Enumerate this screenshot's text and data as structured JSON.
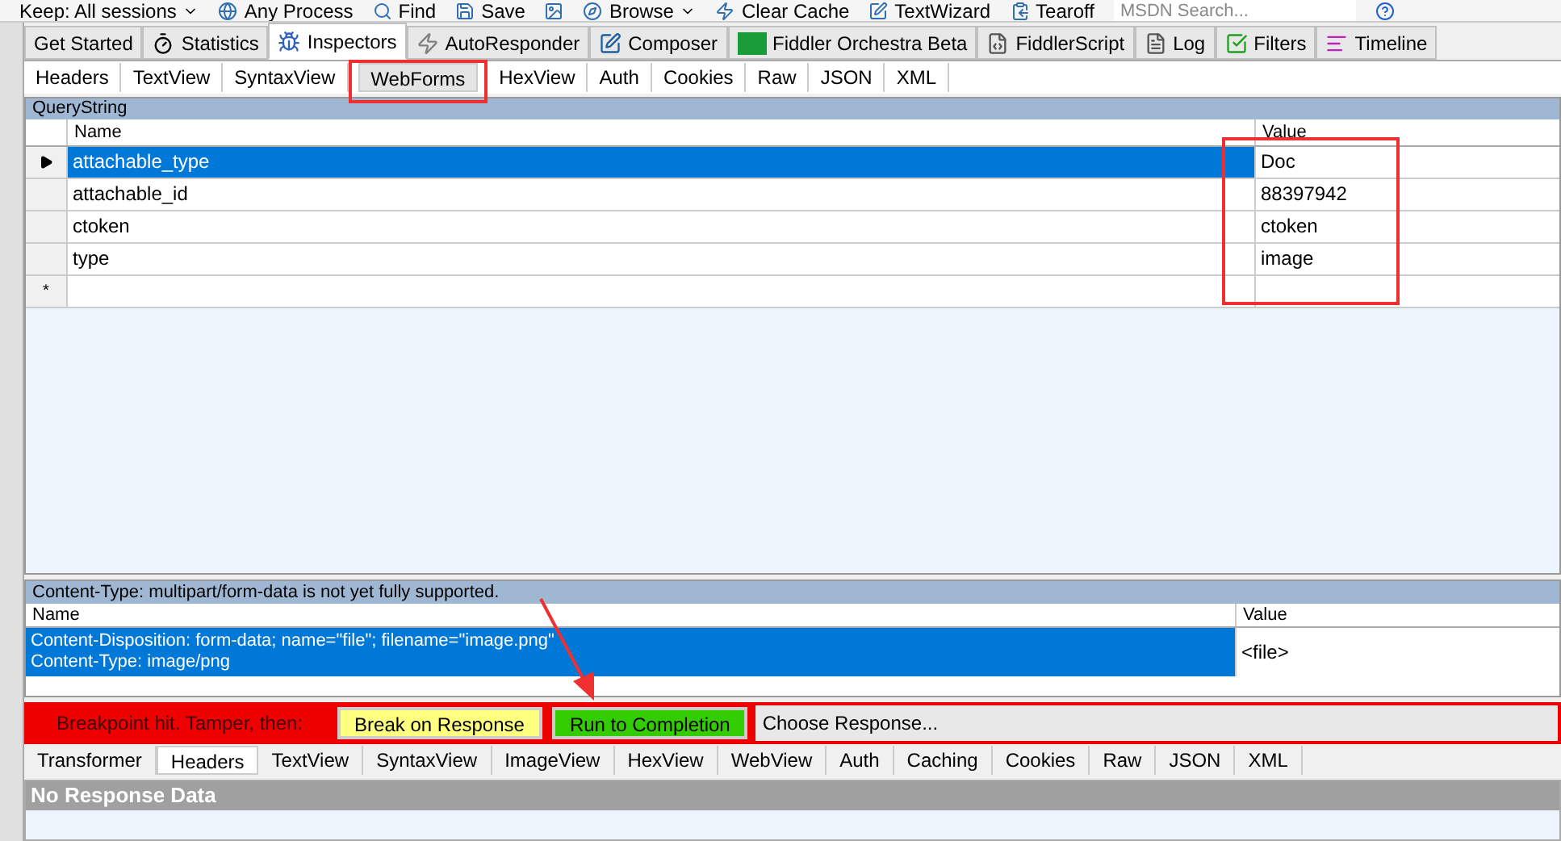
{
  "toolbar": [
    {
      "label": "Keep: All sessions",
      "dropdown": true
    },
    {
      "label": "Any Process",
      "dropdown": false
    },
    {
      "label": "Find",
      "dropdown": false
    },
    {
      "label": "Save",
      "dropdown": false
    },
    {
      "dropdown": false
    },
    {
      "label": "Browse",
      "dropdown": true
    },
    {
      "label": "Clear Cache",
      "dropdown": false
    },
    {
      "label": "TextWizard",
      "dropdown": false
    },
    {
      "label": "Tearoff",
      "dropdown": false
    }
  ],
  "search": {
    "placeholder": "MSDN Search..."
  },
  "tabs": [
    {
      "label": "Get Started",
      "selected": false
    },
    {
      "label": "Statistics",
      "selected": false
    },
    {
      "label": "Inspectors",
      "selected": true
    },
    {
      "label": "AutoResponder",
      "selected": false
    },
    {
      "label": "Composer",
      "selected": false
    },
    {
      "label": "Fiddler Orchestra Beta",
      "selected": false
    },
    {
      "label": "FiddlerScript",
      "selected": false
    },
    {
      "label": "Log",
      "selected": false
    },
    {
      "label": "Filters",
      "selected": false
    },
    {
      "label": "Timeline",
      "selected": false
    }
  ],
  "request_tabs": [
    {
      "label": "Headers",
      "selected": false
    },
    {
      "label": "TextView",
      "selected": false
    },
    {
      "label": "SyntaxView",
      "selected": false
    },
    {
      "label": "WebForms",
      "selected": true
    },
    {
      "label": "HexView",
      "selected": false
    },
    {
      "label": "Auth",
      "selected": false
    },
    {
      "label": "Cookies",
      "selected": false
    },
    {
      "label": "Raw",
      "selected": false
    },
    {
      "label": "JSON",
      "selected": false
    },
    {
      "label": "XML",
      "selected": false
    }
  ],
  "querystring": {
    "title": "QueryString",
    "columns": [
      "Name",
      "Value"
    ],
    "rows": [
      {
        "name": "attachable_type",
        "value": "Doc",
        "selected": true
      },
      {
        "name": "attachable_id",
        "value": "88397942",
        "selected": false
      },
      {
        "name": "ctoken",
        "value": "ctoken",
        "selected": false
      },
      {
        "name": "type",
        "value": "image",
        "selected": false
      }
    ],
    "new_row_marker": "*"
  },
  "body": {
    "title": "Content-Type: multipart/form-data is not yet fully supported.",
    "columns": [
      "Name",
      "Value"
    ],
    "rows": [
      {
        "name_lines": [
          "Content-Disposition: form-data; name=\"file\"; filename=\"image.png\"",
          "Content-Type: image/png"
        ],
        "value": "<file>",
        "selected": true
      }
    ]
  },
  "breakpoint": {
    "message": "Breakpoint hit. Tamper, then:",
    "buttons": [
      {
        "label": "Break on Response",
        "color": "#ffff80"
      },
      {
        "label": "Run to Completion",
        "color": "#33cc00"
      }
    ],
    "response_choice": "Choose Response..."
  },
  "response_tabs": [
    {
      "label": "Transformer",
      "selected": false
    },
    {
      "label": "Headers",
      "selected": true
    },
    {
      "label": "TextView",
      "selected": false
    },
    {
      "label": "SyntaxView",
      "selected": false
    },
    {
      "label": "ImageView",
      "selected": false
    },
    {
      "label": "HexView",
      "selected": false
    },
    {
      "label": "WebView",
      "selected": false
    },
    {
      "label": "Auth",
      "selected": false
    },
    {
      "label": "Caching",
      "selected": false
    },
    {
      "label": "Cookies",
      "selected": false
    },
    {
      "label": "Raw",
      "selected": false
    },
    {
      "label": "JSON",
      "selected": false
    },
    {
      "label": "XML",
      "selected": false
    }
  ],
  "response_status": "No Response Data"
}
